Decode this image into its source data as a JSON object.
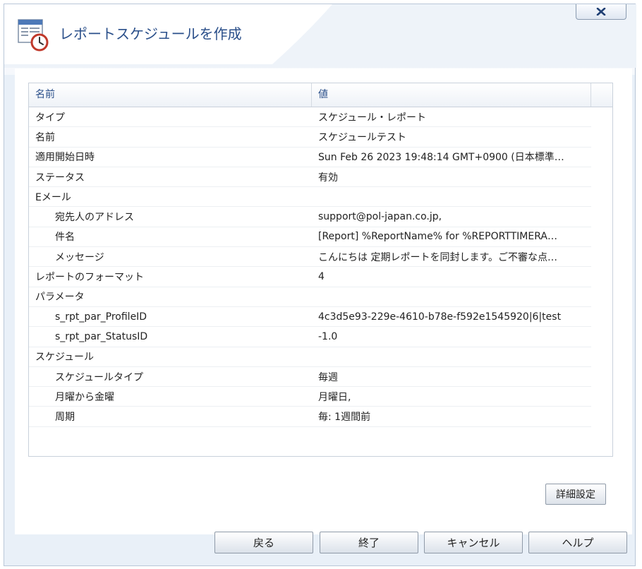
{
  "dialog": {
    "title": "レポートスケジュールを作成",
    "close_label": "x"
  },
  "grid": {
    "columns": [
      "名前",
      "値"
    ],
    "rows": [
      {
        "key": "タイプ",
        "value": "スケジュール・レポート",
        "indent": false
      },
      {
        "key": "名前",
        "value": "スケジュールテスト",
        "indent": false
      },
      {
        "key": "適用開始日時",
        "value": "Sun Feb 26 2023 19:48:14 GMT+0900 (日本標準…",
        "indent": false
      },
      {
        "key": "ステータス",
        "value": "有効",
        "indent": false
      },
      {
        "key": "Eメール",
        "value": "",
        "indent": false
      },
      {
        "key": "宛先人のアドレス",
        "value": "support@pol-japan.co.jp,",
        "indent": true
      },
      {
        "key": "件名",
        "value": "[Report] %ReportName% for %REPORTTIMERA…",
        "indent": true
      },
      {
        "key": "メッセージ",
        "value": "こんにちは 定期レポートを同封します。ご不審な点…",
        "indent": true
      },
      {
        "key": "レポートのフォーマット",
        "value": "4",
        "indent": false
      },
      {
        "key": "パラメータ",
        "value": "",
        "indent": false
      },
      {
        "key": "s_rpt_par_ProfileID",
        "value": "4c3d5e93-229e-4610-b78e-f592e1545920|6|test",
        "indent": true
      },
      {
        "key": "s_rpt_par_StatusID",
        "value": "-1.0",
        "indent": true
      },
      {
        "key": "スケジュール",
        "value": "",
        "indent": false
      },
      {
        "key": "スケジュールタイプ",
        "value": "毎週",
        "indent": true
      },
      {
        "key": "月曜から金曜",
        "value": "月曜日,",
        "indent": true
      },
      {
        "key": "周期",
        "value": "毎: 1週間前",
        "indent": true
      }
    ]
  },
  "buttons": {
    "advanced": "詳細設定",
    "back": "戻る",
    "finish": "終了",
    "cancel": "キャンセル",
    "help": "ヘルプ"
  }
}
